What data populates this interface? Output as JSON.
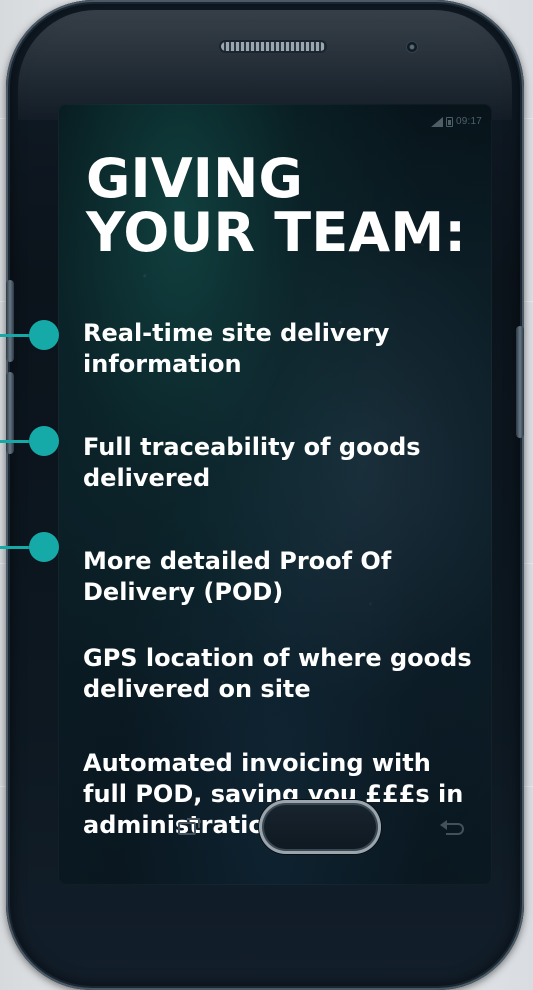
{
  "status": {
    "time": "09:17"
  },
  "headline": {
    "line1": "GIVING",
    "line2": "YOUR TEAM:"
  },
  "benefits": [
    {
      "text": "Real-time site delivery information",
      "marked": true
    },
    {
      "text": "Full traceability of goods delivered",
      "marked": true
    },
    {
      "text": "More detailed Proof Of Delivery (POD)",
      "marked": true
    },
    {
      "text": "GPS location of where goods delivered on site",
      "marked": false
    },
    {
      "text": "Automated invoicing with full POD, saving you £££s in administration costs",
      "marked": false
    }
  ],
  "colors": {
    "accent": "#15aaa7",
    "phone_body": "#0d1821",
    "screen_glow": "#14544f",
    "text": "#ffffff"
  },
  "icons": {
    "signal": "signal-icon",
    "battery": "battery-icon",
    "recent": "recent-apps-icon",
    "back": "back-icon"
  }
}
